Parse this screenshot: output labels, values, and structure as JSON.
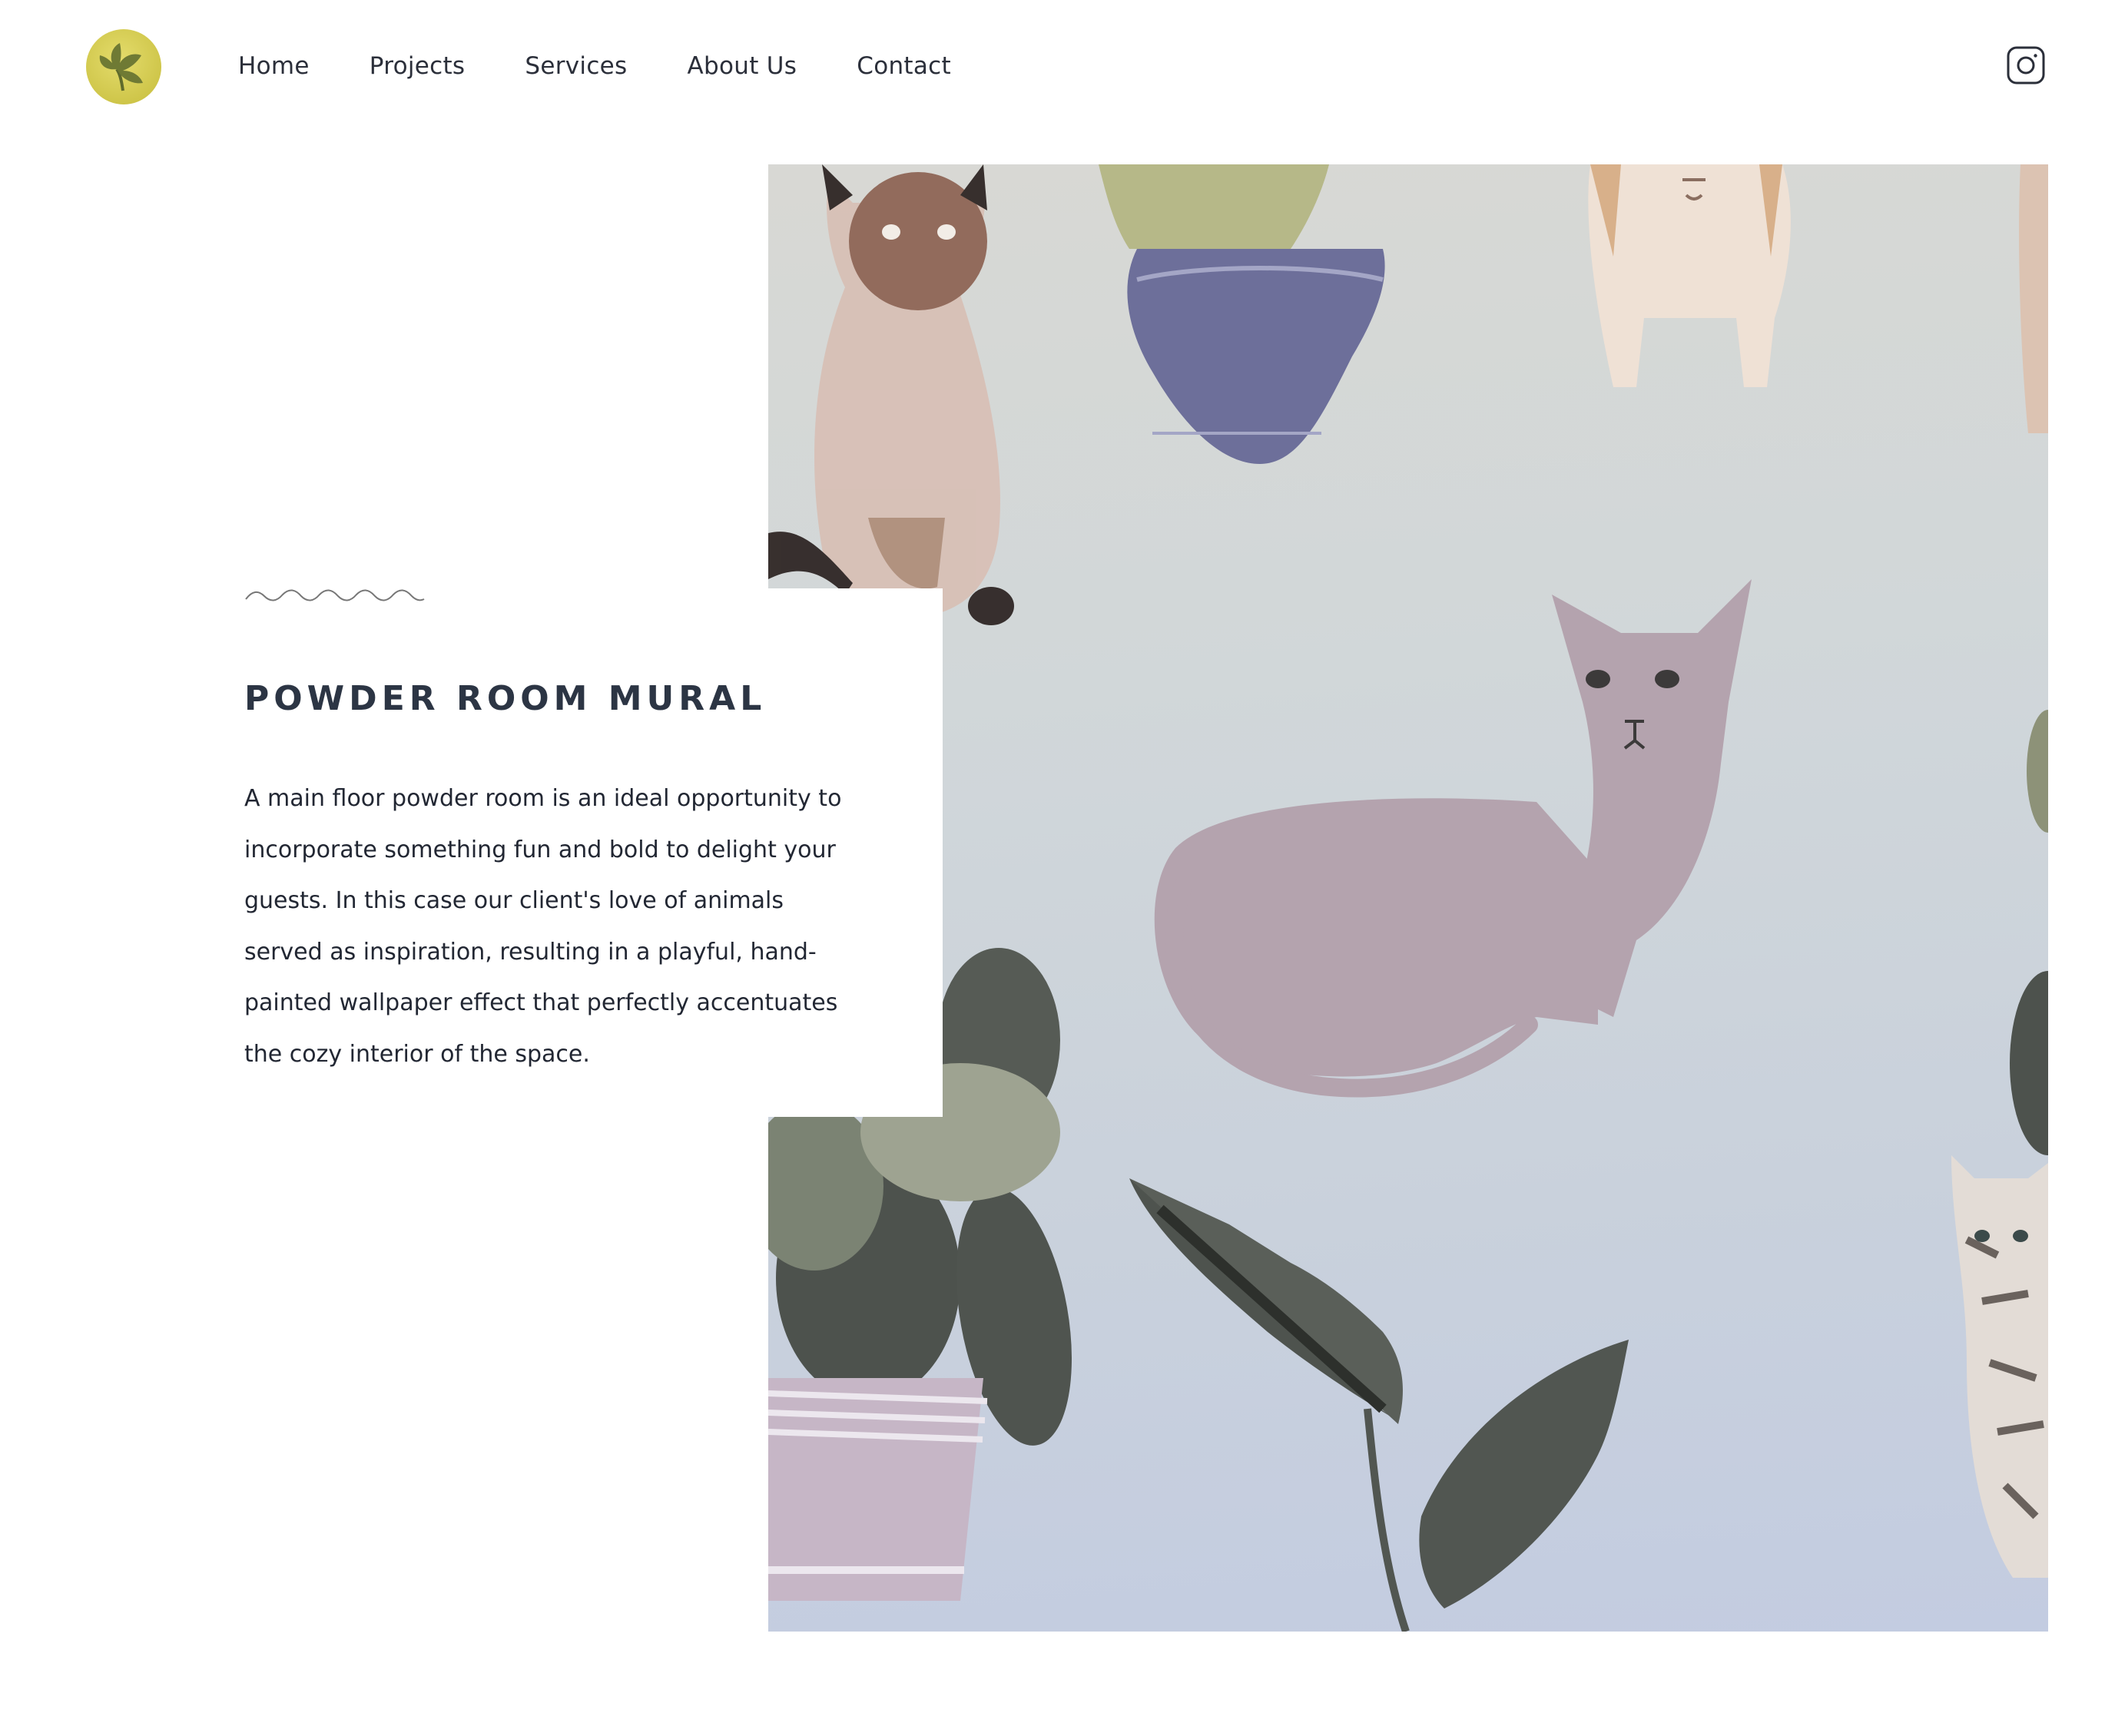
{
  "header": {
    "logo_name": "leaf-logo",
    "nav": [
      {
        "label": "Home"
      },
      {
        "label": "Projects"
      },
      {
        "label": "Services"
      },
      {
        "label": "About Us"
      },
      {
        "label": "Contact"
      }
    ],
    "social_icon": "instagram-icon"
  },
  "project": {
    "title": "POWDER ROOM MURAL",
    "description": "A main floor powder room is an ideal opportunity to incorporate something fun and bold to delight your guests. In this case our client's love of animals served as inspiration, resulting in a playful, hand-painted wallpaper effect that perfectly accentuates the cozy interior of the space."
  },
  "colors": {
    "logo_yellow": "#d9d156",
    "leaf_green": "#6f7a34",
    "title_navy": "#2c3544",
    "text": "#222733"
  }
}
